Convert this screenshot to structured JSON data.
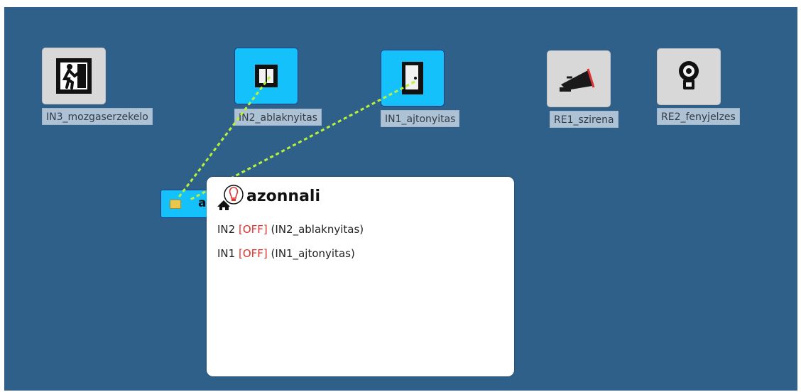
{
  "devices": [
    {
      "label": "IN3_mozgaserzekelo",
      "icon": "emergency-exit-icon",
      "active": false
    },
    {
      "label": "IN2_ablaknyitas",
      "icon": "window-icon",
      "active": true
    },
    {
      "label": "IN1_ajtonyitas",
      "icon": "door-icon",
      "active": true
    },
    {
      "label": "RE1_szirena",
      "icon": "siren-megaphone-icon",
      "active": false
    },
    {
      "label": "RE2_fenyjelzes",
      "icon": "beacon-light-icon",
      "active": false
    }
  ],
  "scenario_node": {
    "label": "a",
    "icon": "chip-card-icon"
  },
  "popup": {
    "icon": "alarm-house-icon",
    "title": "azonnali",
    "rows": [
      {
        "id": "IN2",
        "state": "[OFF]",
        "name": "(IN2_ablaknyitas)"
      },
      {
        "id": "IN1",
        "state": "[OFF]",
        "name": "(IN1_ajtonyitas)"
      }
    ]
  },
  "colors": {
    "canvas_bg": "#2f6089",
    "active_tile": "#15c1fb",
    "link_line": "#b9f23a",
    "off_state": "#e0322b"
  }
}
